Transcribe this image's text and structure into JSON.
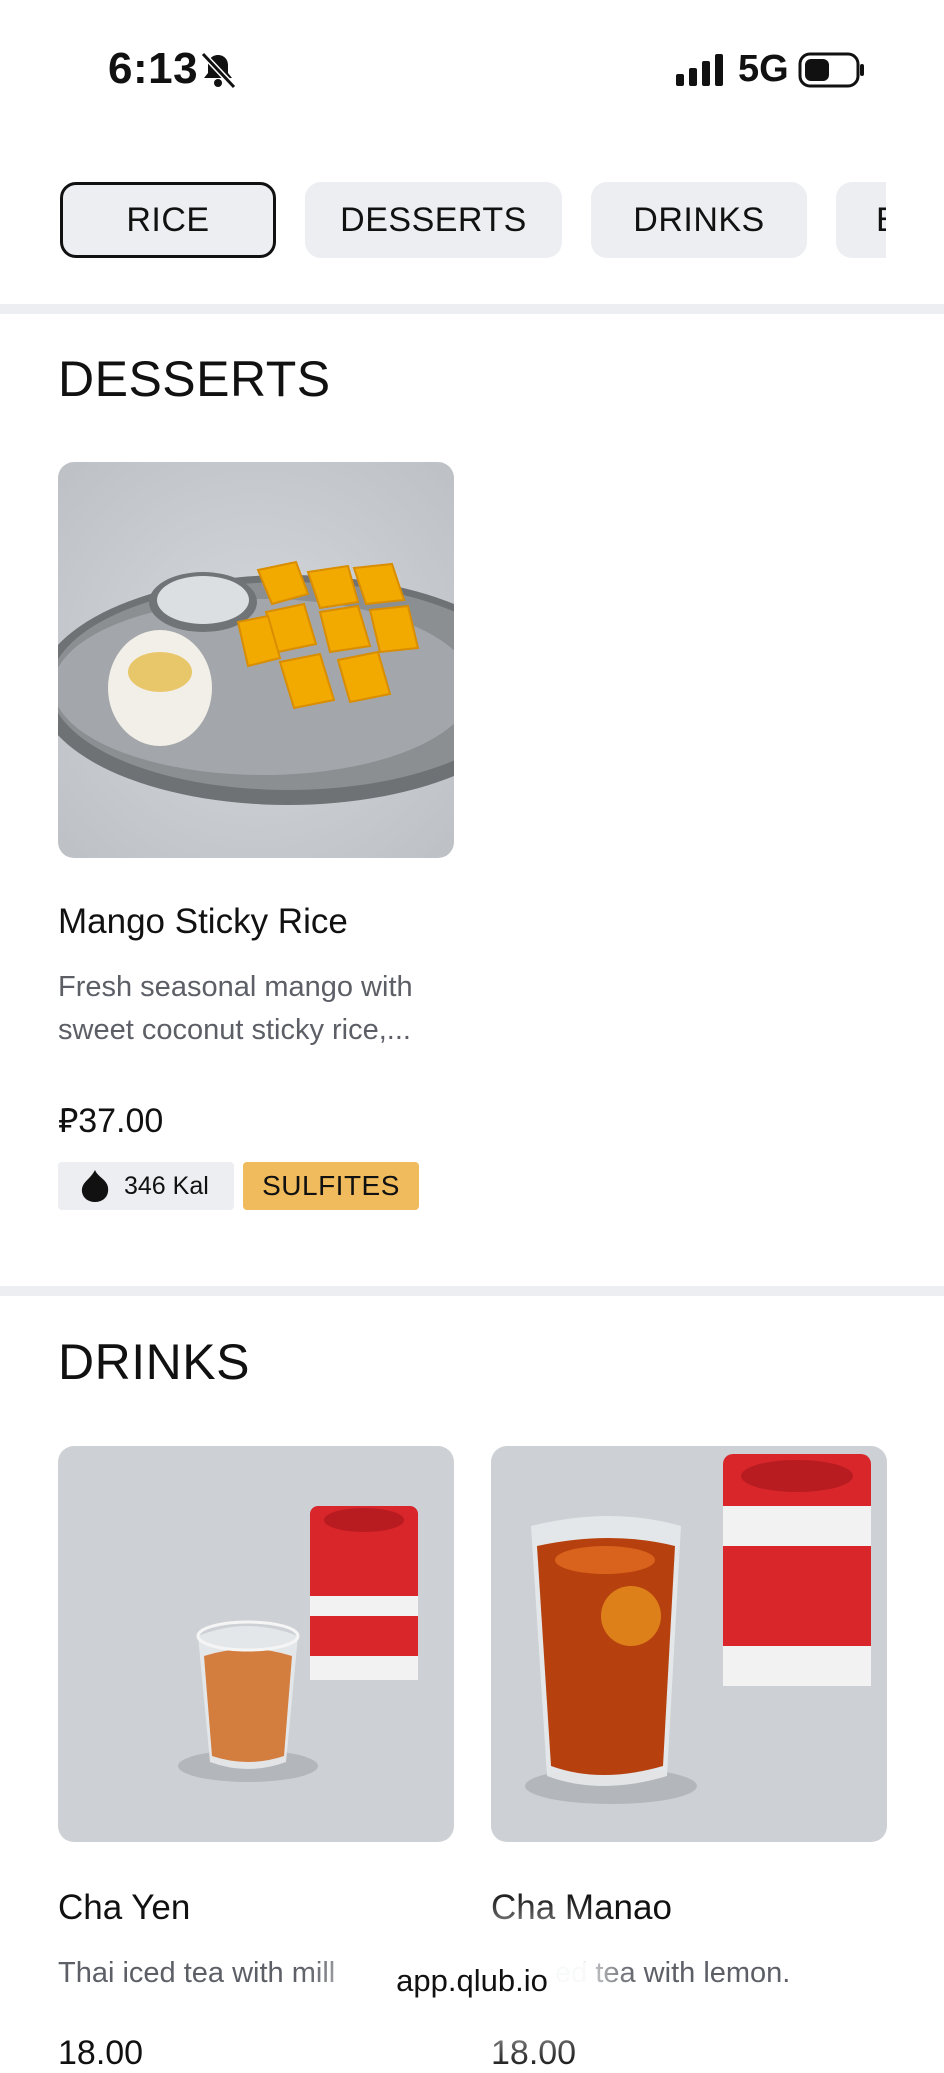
{
  "status_bar": {
    "time": "6:13",
    "network": "5G",
    "icons": [
      "bell-slash-icon",
      "signal-icon",
      "battery-icon"
    ]
  },
  "tabs": [
    {
      "label": "RICE",
      "active": true
    },
    {
      "label": "DESSERTS",
      "active": false
    },
    {
      "label": "DRINKS",
      "active": false
    },
    {
      "label": "E",
      "active": false
    }
  ],
  "sections": {
    "desserts": {
      "title": "DESSERTS",
      "items": [
        {
          "name": "Mango Sticky Rice",
          "description_line1": "Fresh seasonal mango with",
          "description_line2": "sweet coconut sticky rice,...",
          "price": "37.00",
          "currency_symbol": "⃁",
          "calories": "346 Kal",
          "allergen": "SULFITES"
        }
      ]
    },
    "drinks": {
      "title": "DRINKS",
      "items": [
        {
          "name": "Cha Yen",
          "description": "Thai iced tea with mill",
          "price": "18.00"
        },
        {
          "name": "Cha Manao",
          "description": "ed tea with lemon.",
          "price": "18.00"
        }
      ]
    }
  },
  "browser": {
    "url": "app.qlub.io"
  },
  "colors": {
    "tab_bg": "#eceef2",
    "allergen_bg": "#f0bb5c",
    "muted_text": "#5c5f66"
  }
}
